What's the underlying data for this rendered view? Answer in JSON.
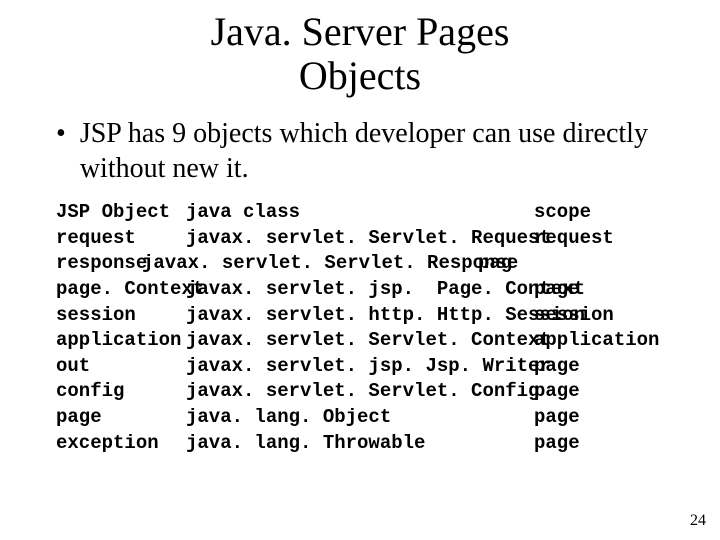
{
  "title_line1": "Java. Server Pages",
  "title_line2": "Objects",
  "bullet_text": "JSP has 9 objects which developer can use directly without new it.",
  "header": {
    "c1": "JSP Object",
    "c2": "java class",
    "c3": "scope"
  },
  "rows": [
    {
      "c1": "request",
      "c2": "javax. servlet. Servlet. Request",
      "c3": "request"
    },
    {
      "c1": "response",
      "c2": "javax. servlet. Servlet. Response",
      "c3": "pag",
      "oddball": true
    },
    {
      "c1": "page. Context",
      "c2": "javax. servlet. jsp.  Page. Context",
      "c3": "page"
    },
    {
      "c1": "session",
      "c2": "javax. servlet. http. Http. Session",
      "c3": "session"
    },
    {
      "c1": "application",
      "c2": "javax. servlet. Servlet. Context",
      "c3": "application"
    },
    {
      "c1": "out",
      "c2": "javax. servlet. jsp. Jsp. Writer",
      "c3": "page"
    },
    {
      "c1": "config",
      "c2": "javax. servlet. Servlet. Config",
      "c3": "page"
    },
    {
      "c1": "page",
      "c2": "java. lang. Object",
      "c3": "page"
    },
    {
      "c1": "exception",
      "c2": "java. lang. Throwable",
      "c3": "page"
    }
  ],
  "page_number": "24"
}
